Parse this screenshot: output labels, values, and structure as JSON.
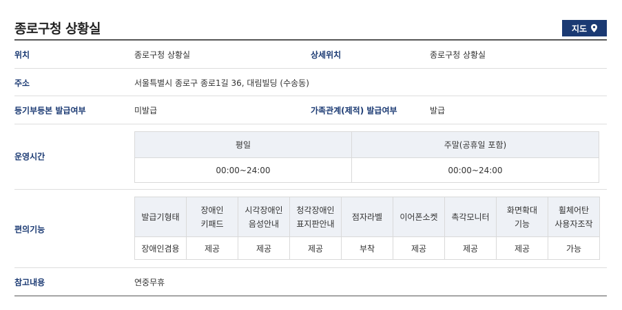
{
  "header": {
    "title": "종로구청 상황실",
    "map_button_label": "지도"
  },
  "info": {
    "location_label": "위치",
    "location_value": "종로구청 상황실",
    "detail_location_label": "상세위치",
    "detail_location_value": "종로구청 상황실",
    "address_label": "주소",
    "address_value": "서울특별시 종로구 종로1길 36, 대림빌딩 (수송동)",
    "registry_label": "등기부등본 발급여부",
    "registry_value": "미발급",
    "family_label": "가족관계(제적) 발급여부",
    "family_value": "발급",
    "hours_label": "운영시간",
    "convenience_label": "편의기능",
    "notes_label": "참고내용",
    "notes_value": "연중무휴"
  },
  "hours": {
    "headers": [
      "평일",
      "주말(공휴일 포함)"
    ],
    "values": [
      "00:00~24:00",
      "00:00~24:00"
    ]
  },
  "convenience": {
    "headers": [
      "발급기형태",
      "장애인\n키패드",
      "시각장애인\n음성안내",
      "청각장애인\n표지판안내",
      "점자라벨",
      "이어폰소켓",
      "촉각모니터",
      "화면확대\n기능",
      "휠체어탄\n사용자조작"
    ],
    "values": [
      "장애인겸용",
      "제공",
      "제공",
      "제공",
      "부착",
      "제공",
      "제공",
      "제공",
      "가능"
    ]
  },
  "colors": {
    "accent": "#1b3a73",
    "header_cell_bg": "#eef1f6"
  }
}
